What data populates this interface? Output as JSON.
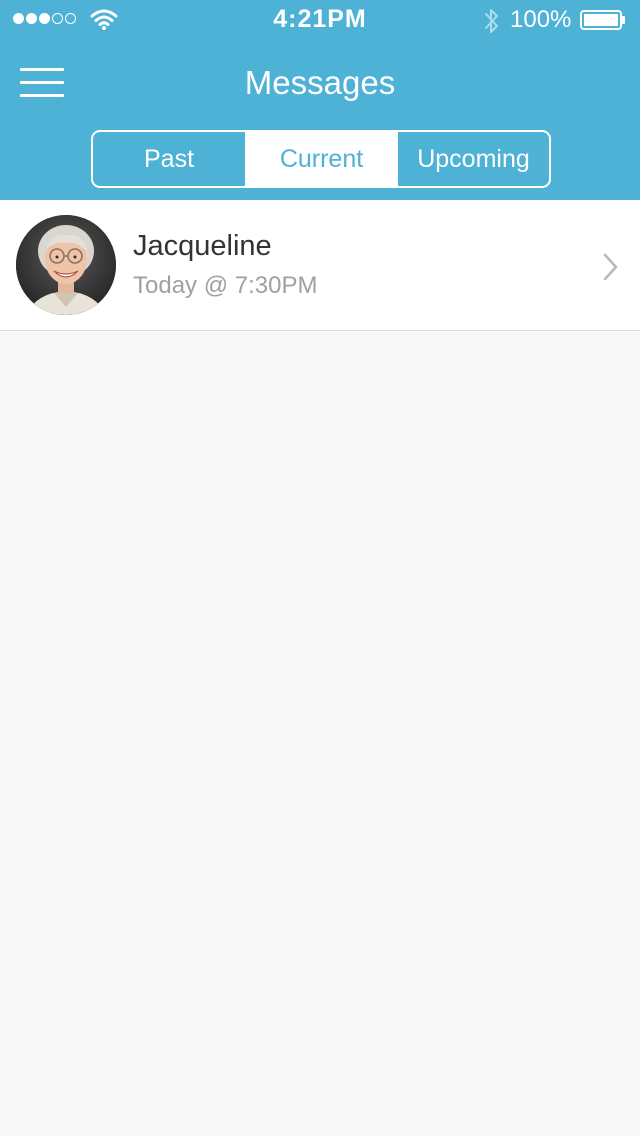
{
  "status_bar": {
    "time": "4:21PM",
    "battery_percent": "100%",
    "signal_bars_filled": 3,
    "signal_bars_total": 5
  },
  "nav": {
    "title": "Messages",
    "menu_icon": "hamburger-menu-icon"
  },
  "tabs": [
    {
      "label": "Past",
      "active": false
    },
    {
      "label": "Current",
      "active": true
    },
    {
      "label": "Upcoming",
      "active": false
    }
  ],
  "messages": [
    {
      "name": "Jacqueline",
      "time": "Today @ 7:30PM",
      "avatar_icon": "user-avatar-photo"
    }
  ],
  "colors": {
    "accent": "#4db2d6",
    "background": "#f8f8f8",
    "row_background": "#ffffff",
    "primary_text": "#333333",
    "secondary_text": "#a0a0a0"
  }
}
